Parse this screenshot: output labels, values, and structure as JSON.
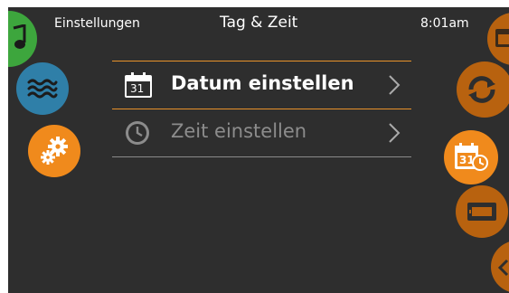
{
  "header": {
    "breadcrumb": "Einstellungen",
    "title": "Tag & Zeit",
    "time": "8:01am"
  },
  "menu": {
    "items": [
      {
        "label": "Datum einstellen",
        "icon": "calendar-icon",
        "calendar_number": "31",
        "state": "selected"
      },
      {
        "label": "Zeit einstellen",
        "icon": "clock-icon",
        "state": "normal"
      }
    ]
  },
  "left_nav": {
    "icons": [
      "music-icon",
      "water-waves-icon",
      "gears-icon"
    ]
  },
  "right_nav": {
    "icons": [
      "calendar-icon",
      "refresh-icon",
      "calendar-clock-icon",
      "display-icon",
      "more-icon"
    ],
    "calendar_clock_number": "31"
  },
  "colors": {
    "background": "#2e2e2e",
    "accent_orange": "#f08a1c",
    "dim_orange": "#b8620f",
    "water_blue": "#2f7fa8",
    "green": "#3da63d",
    "divider": "#8a8a8a",
    "text": "#ffffff",
    "text_dim": "#8c8c8c"
  }
}
